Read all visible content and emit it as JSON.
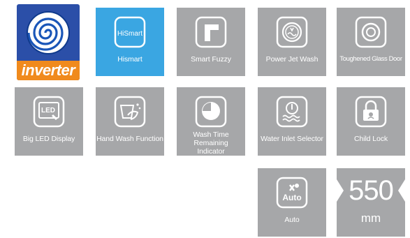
{
  "logo": {
    "text": "inverter"
  },
  "features": [
    {
      "label": "Hismart",
      "icon": "hismart-icon",
      "badge": "HiSmart"
    },
    {
      "label": "Smart Fuzzy",
      "icon": "smart-fuzzy-icon"
    },
    {
      "label": "Power Jet Wash",
      "icon": "power-jet-wash-icon"
    },
    {
      "label": "Toughened Glass Door",
      "icon": "glass-door-icon"
    },
    {
      "label": "Big LED Display",
      "icon": "led-display-icon",
      "badge": "LED"
    },
    {
      "label": "Hand Wash Function",
      "icon": "hand-wash-icon"
    },
    {
      "label": "Wash Time Remaining Indicator",
      "icon": "wash-time-icon"
    },
    {
      "label": "Water Inlet Selector",
      "icon": "water-inlet-icon"
    },
    {
      "label": "Child Lock",
      "icon": "child-lock-icon"
    },
    {
      "label": "Auto",
      "icon": "auto-icon",
      "badge": "Auto"
    }
  ],
  "dimension": {
    "value": "550",
    "unit": "mm"
  },
  "colors": {
    "tile": "#a6a7a9",
    "highlight": "#3aa6e2",
    "logo_blue": "#2b4fa8",
    "logo_orange": "#f08a1d"
  }
}
